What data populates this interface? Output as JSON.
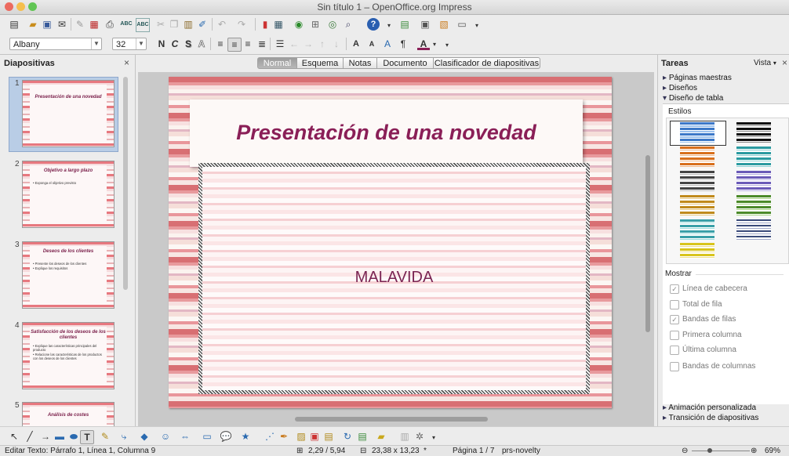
{
  "window": {
    "title": "Sin título 1 – OpenOffice.org Impress"
  },
  "format_bar": {
    "font_name": "Albany",
    "font_size": "32",
    "bold": "N",
    "italic": "C",
    "shadow": "S",
    "outline": "A"
  },
  "slides_panel": {
    "title": "Diapositivas",
    "slides": [
      {
        "number": "1",
        "title": "Presentación de una novedad",
        "bullets": []
      },
      {
        "number": "2",
        "title": "Objetivo a largo plazo",
        "bullets": [
          "Exponga el objetivo previsto"
        ]
      },
      {
        "number": "3",
        "title": "Deseos de los clientes",
        "bullets": [
          "Presente los deseos de los clientes",
          "Explique los requisitos"
        ]
      },
      {
        "number": "4",
        "title": "Satisfacción de los deseos de los clientes",
        "bullets": [
          "Explique las características principales del producto",
          "Relacione las características de los productos con los deseos de los clientes"
        ]
      },
      {
        "number": "5",
        "title": "Análisis de costes",
        "bullets": []
      }
    ]
  },
  "view_tabs": [
    "Normal",
    "Esquema",
    "Notas",
    "Documento",
    "Clasificador de diapositivas"
  ],
  "slide": {
    "title": "Presentación de una novedad",
    "body": "MALAVIDA"
  },
  "tasks_panel": {
    "title": "Tareas",
    "view_label": "Vista",
    "sections": {
      "master_pages": "Páginas maestras",
      "layouts": "Diseños",
      "table_design": "Diseño de tabla",
      "custom_animation": "Animación personalizada",
      "slide_transition": "Transición de diapositivas"
    },
    "styles_label": "Estilos",
    "show_label": "Mostrar",
    "options": [
      {
        "label": "Línea de cabecera",
        "checked": true
      },
      {
        "label": "Total de fila",
        "checked": false
      },
      {
        "label": "Bandas de filas",
        "checked": true
      },
      {
        "label": "Primera columna",
        "checked": false
      },
      {
        "label": "Última columna",
        "checked": false
      },
      {
        "label": "Bandas de columnas",
        "checked": false
      }
    ]
  },
  "status": {
    "text": "Editar Texto: Párrafo 1, Línea 1, Columna 9",
    "position": "2,29 / 5,94",
    "size": "23,38 x 13,23",
    "page": "Página 1 / 7",
    "master": "prs-novelty",
    "zoom": "69%"
  }
}
